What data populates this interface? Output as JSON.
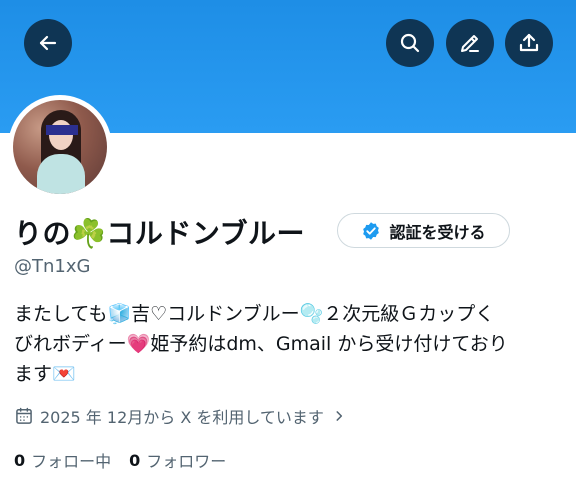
{
  "profile": {
    "display_name": "りの☘️コルドンブルー",
    "handle": "@Tn1xG",
    "verify_button_label": "認証を受ける",
    "bio": "またしても🧊吉♡コルドンブルー🫧２次元級Ｇカップく\nびれボディー💗姫予約はdm、Gmail から受け付けており\nます💌",
    "joined": "2025 年 12月から X を利用しています",
    "following_count": "0",
    "following_label": "フォロー中",
    "followers_count": "0",
    "followers_label": "フォロワー"
  },
  "header": {
    "back_icon": "arrow-left-icon",
    "search_icon": "search-icon",
    "edit_icon": "pencil-icon",
    "share_icon": "share-upload-icon"
  },
  "colors": {
    "banner": "#2a9cf2",
    "header_button": "#0f3554",
    "verified_badge": "#1d9bf0",
    "text_primary": "#0f1419",
    "text_secondary": "#536471"
  }
}
